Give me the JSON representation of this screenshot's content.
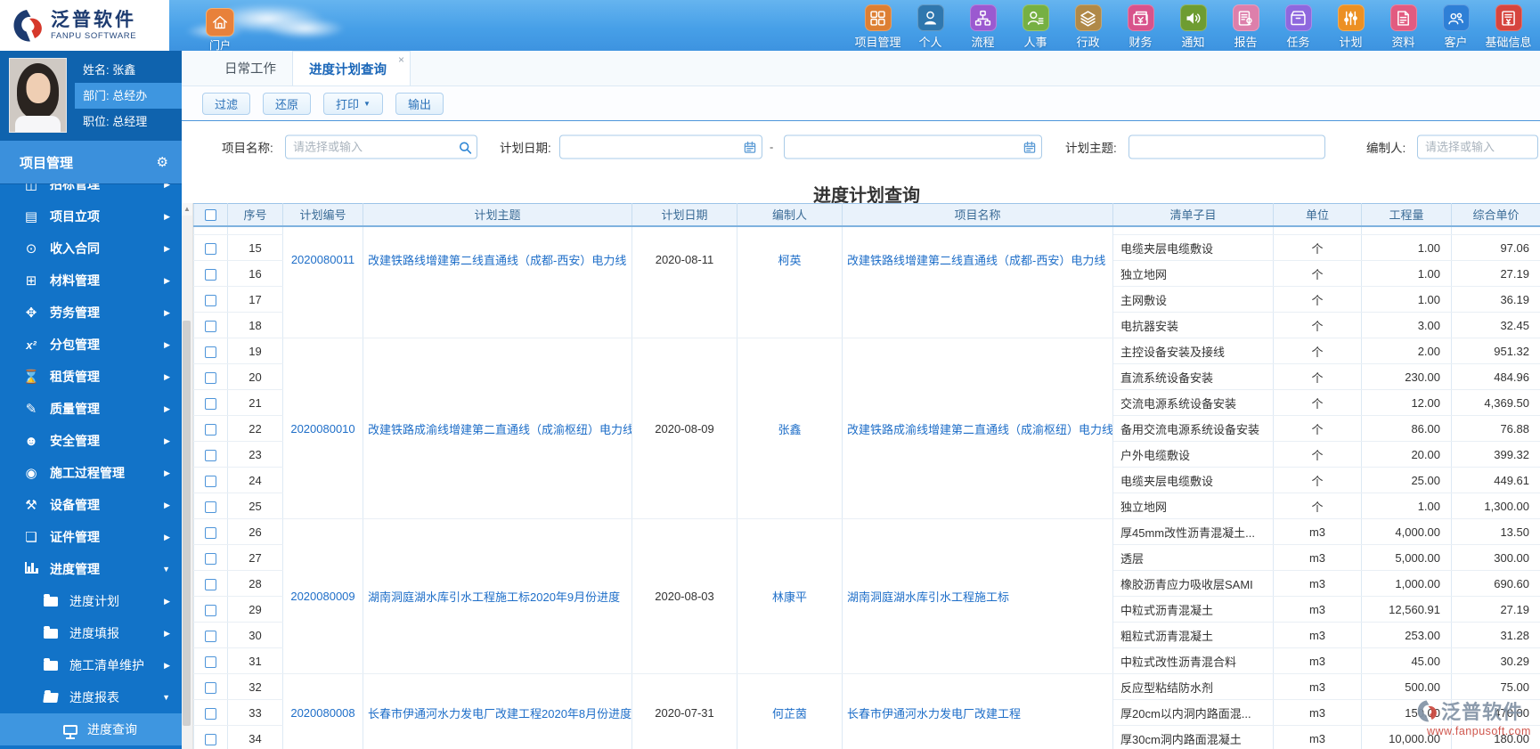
{
  "brand": {
    "name": "泛普软件",
    "subtitle": "FANPU SOFTWARE"
  },
  "topbar": {
    "portal": {
      "label": "门户",
      "color": "#e8813b"
    },
    "modules": [
      {
        "label": "项目管理",
        "icon": "grid",
        "color": "#dd7f33"
      },
      {
        "label": "个人",
        "icon": "person",
        "color": "#2f77ae"
      },
      {
        "label": "流程",
        "icon": "flow",
        "color": "#9b59d0"
      },
      {
        "label": "人事",
        "icon": "person-lines",
        "color": "#76b043"
      },
      {
        "label": "行政",
        "icon": "layers",
        "color": "#b08948"
      },
      {
        "label": "财务",
        "icon": "money",
        "color": "#d8538b"
      },
      {
        "label": "通知",
        "icon": "speaker",
        "color": "#6e9c31"
      },
      {
        "label": "报告",
        "icon": "report",
        "color": "#dd7fab"
      },
      {
        "label": "任务",
        "icon": "box",
        "color": "#8e68de"
      },
      {
        "label": "计划",
        "icon": "sliders",
        "color": "#ec9023"
      },
      {
        "label": "资料",
        "icon": "doc",
        "color": "#e25b80"
      },
      {
        "label": "客户",
        "icon": "people",
        "color": "#2e7fd6"
      },
      {
        "label": "基础信息",
        "icon": "info-doc",
        "color": "#d6453e"
      }
    ]
  },
  "user": {
    "name_line": "姓名: 张鑫",
    "dept_line": "部门: 总经办",
    "title_line": "职位: 总经理"
  },
  "sidebar": {
    "header": {
      "label": "项目管理"
    },
    "items": [
      {
        "label": "招标管理",
        "icon": "bid",
        "level": 1,
        "arrow": "right"
      },
      {
        "label": "项目立项",
        "icon": "stack",
        "level": 1,
        "arrow": "right"
      },
      {
        "label": "收入合同",
        "icon": "banknote",
        "level": 1,
        "arrow": "right"
      },
      {
        "label": "材料管理",
        "icon": "cart",
        "level": 1,
        "arrow": "right"
      },
      {
        "label": "劳务管理",
        "icon": "labor",
        "level": 1,
        "arrow": "right"
      },
      {
        "label": "分包管理",
        "icon": "x2",
        "level": 1,
        "arrow": "right"
      },
      {
        "label": "租赁管理",
        "icon": "hourglass",
        "level": 1,
        "arrow": "right"
      },
      {
        "label": "质量管理",
        "icon": "pencil",
        "level": 1,
        "arrow": "right"
      },
      {
        "label": "安全管理",
        "icon": "helmet",
        "level": 1,
        "arrow": "right"
      },
      {
        "label": "施工过程管理",
        "icon": "compass",
        "level": 1,
        "arrow": "right"
      },
      {
        "label": "设备管理",
        "icon": "tools",
        "level": 1,
        "arrow": "right"
      },
      {
        "label": "证件管理",
        "icon": "card",
        "level": 1,
        "arrow": "right"
      },
      {
        "label": "进度管理",
        "icon": "chart",
        "level": 1,
        "arrow": "down",
        "expanded": true
      },
      {
        "label": "进度计划",
        "icon": "folder",
        "level": 2,
        "arrow": "right"
      },
      {
        "label": "进度填报",
        "icon": "folder",
        "level": 2,
        "arrow": "right"
      },
      {
        "label": "施工清单维护",
        "icon": "folder",
        "level": 2,
        "arrow": "right"
      },
      {
        "label": "进度报表",
        "icon": "folder-open",
        "level": 2,
        "arrow": "down",
        "expanded": true
      },
      {
        "label": "进度查询",
        "icon": "monitor",
        "level": 3,
        "active": true
      }
    ]
  },
  "tabs": [
    {
      "label": "日常工作",
      "active": false
    },
    {
      "label": "进度计划查询",
      "active": true,
      "close": "×"
    }
  ],
  "toolbar": [
    {
      "label": "过滤"
    },
    {
      "label": "还原"
    },
    {
      "label": "打印",
      "caret": true
    },
    {
      "label": "输出"
    }
  ],
  "filters": {
    "project_name": {
      "label": "项目名称:",
      "placeholder": "请选择或输入",
      "value": ""
    },
    "plan_date": {
      "label": "计划日期:",
      "from": "",
      "to": "",
      "separator": "-"
    },
    "plan_subject": {
      "label": "计划主题:",
      "value": ""
    },
    "creator": {
      "label": "编制人:",
      "placeholder": "请选择或输入",
      "value": ""
    }
  },
  "page_title": "进度计划查询",
  "table": {
    "columns": [
      "序号",
      "计划编号",
      "计划主题",
      "计划日期",
      "编制人",
      "项目名称",
      "清单子目",
      "单位",
      "工程量",
      "综合单价"
    ],
    "groups": [
      {
        "plan_no": "2020080011",
        "subject": "改建铁路线增建第二线直通线（成都-西安）电力线",
        "date": "2020-08-11",
        "creator": "柯英",
        "project": "改建铁路线增建第二线直通线（成都-西安）电力线",
        "rows": [
          {
            "seq": "15",
            "item": "电缆夹层电缆敷设",
            "unit": "个",
            "qty": "1.00",
            "price": "97.06"
          },
          {
            "seq": "16",
            "item": "独立地网",
            "unit": "个",
            "qty": "1.00",
            "price": "27.19"
          },
          {
            "seq": "17",
            "item": "主网敷设",
            "unit": "个",
            "qty": "1.00",
            "price": "36.19"
          },
          {
            "seq": "18",
            "item": "电抗器安装",
            "unit": "个",
            "qty": "3.00",
            "price": "32.45"
          }
        ]
      },
      {
        "plan_no": "2020080010",
        "subject": "改建铁路成渝线增建第二直通线（成渝枢纽）电力线",
        "date": "2020-08-09",
        "creator": "张鑫",
        "project": "改建铁路成渝线增建第二直通线（成渝枢纽）电力线",
        "rows": [
          {
            "seq": "19",
            "item": "主控设备安装及接线",
            "unit": "个",
            "qty": "2.00",
            "price": "951.32"
          },
          {
            "seq": "20",
            "item": "直流系统设备安装",
            "unit": "个",
            "qty": "230.00",
            "price": "484.96"
          },
          {
            "seq": "21",
            "item": "交流电源系统设备安装",
            "unit": "个",
            "qty": "12.00",
            "price": "4,369.50"
          },
          {
            "seq": "22",
            "item": "备用交流电源系统设备安装",
            "unit": "个",
            "qty": "86.00",
            "price": "76.88"
          },
          {
            "seq": "23",
            "item": "户外电缆敷设",
            "unit": "个",
            "qty": "20.00",
            "price": "399.32"
          },
          {
            "seq": "24",
            "item": "电缆夹层电缆敷设",
            "unit": "个",
            "qty": "25.00",
            "price": "449.61"
          },
          {
            "seq": "25",
            "item": "独立地网",
            "unit": "个",
            "qty": "1.00",
            "price": "1,300.00"
          }
        ]
      },
      {
        "plan_no": "2020080009",
        "subject": "湖南洞庭湖水库引水工程施工标2020年9月份进度",
        "date": "2020-08-03",
        "creator": "林康平",
        "project": "湖南洞庭湖水库引水工程施工标",
        "rows": [
          {
            "seq": "26",
            "item": "厚45mm改性沥青混凝土...",
            "unit": "m3",
            "qty": "4,000.00",
            "price": "13.50"
          },
          {
            "seq": "27",
            "item": "透层",
            "unit": "m3",
            "qty": "5,000.00",
            "price": "300.00"
          },
          {
            "seq": "28",
            "item": "橡胶沥青应力吸收层SAMI",
            "unit": "m3",
            "qty": "1,000.00",
            "price": "690.60"
          },
          {
            "seq": "29",
            "item": "中粒式沥青混凝土",
            "unit": "m3",
            "qty": "12,560.91",
            "price": "27.19"
          },
          {
            "seq": "30",
            "item": "粗粒式沥青混凝土",
            "unit": "m3",
            "qty": "253.00",
            "price": "31.28"
          },
          {
            "seq": "31",
            "item": "中粒式改性沥青混合料",
            "unit": "m3",
            "qty": "45.00",
            "price": "30.29"
          }
        ]
      },
      {
        "plan_no": "2020080008",
        "subject": "长春市伊通河水力发电厂改建工程2020年8月份进度",
        "date": "2020-07-31",
        "creator": "何芷茵",
        "project": "长春市伊通河水力发电厂改建工程",
        "rows": [
          {
            "seq": "32",
            "item": "反应型粘结防水剂",
            "unit": "m3",
            "qty": "500.00",
            "price": "75.00"
          },
          {
            "seq": "33",
            "item": "厚20cm以内洞内路面混...",
            "unit": "m3",
            "qty": "150.00",
            "price": "470.00"
          },
          {
            "seq": "34",
            "item": "厚30cm洞内路面混凝土",
            "unit": "m3",
            "qty": "10,000.00",
            "price": "180.00"
          }
        ]
      }
    ]
  },
  "watermark": {
    "name": "泛普软件",
    "url": "www.fanpusoft.com"
  },
  "colors": {
    "topbar": "#47a0e8",
    "sidebar": "#1273c8",
    "sidebar_highlight": "#3e96e0",
    "link": "#1e6ec8",
    "table_header_bg": "#e9f2fb"
  }
}
